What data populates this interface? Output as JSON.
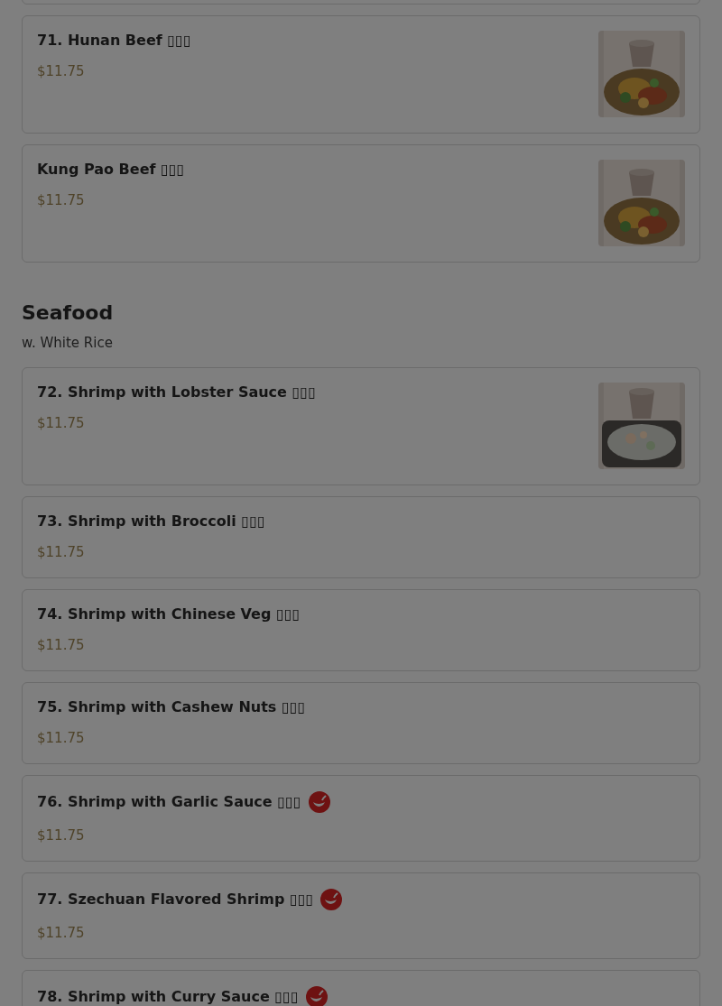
{
  "sections": [
    {
      "items": [
        {
          "name": "71. Hunan Beef ▯▯▯",
          "price": "$11.75",
          "spicy": false,
          "picture": true
        },
        {
          "name": "Kung Pao Beef ▯▯▯",
          "price": "$11.75",
          "spicy": false,
          "picture": true
        }
      ]
    },
    {
      "title": "Seafood",
      "subtitle": "w. White Rice",
      "items": [
        {
          "name": "72. Shrimp with Lobster Sauce ▯▯▯",
          "price": "$11.75",
          "spicy": false,
          "picture": true
        },
        {
          "name": "73. Shrimp with Broccoli ▯▯▯",
          "price": "$11.75",
          "spicy": false,
          "picture": false
        },
        {
          "name": "74. Shrimp with Chinese Veg ▯▯▯",
          "price": "$11.75",
          "spicy": false,
          "picture": false
        },
        {
          "name": "75. Shrimp with Cashew Nuts ▯▯▯",
          "price": "$11.75",
          "spicy": false,
          "picture": false
        },
        {
          "name": "76. Shrimp with Garlic Sauce ▯▯▯",
          "price": "$11.75",
          "spicy": true,
          "picture": false
        },
        {
          "name": "77. Szechuan Flavored Shrimp ▯▯▯",
          "price": "$11.75",
          "spicy": true,
          "picture": false
        },
        {
          "name": "78. Shrimp with Curry Sauce ▯▯▯",
          "spicy": true,
          "picture": false
        }
      ]
    }
  ]
}
